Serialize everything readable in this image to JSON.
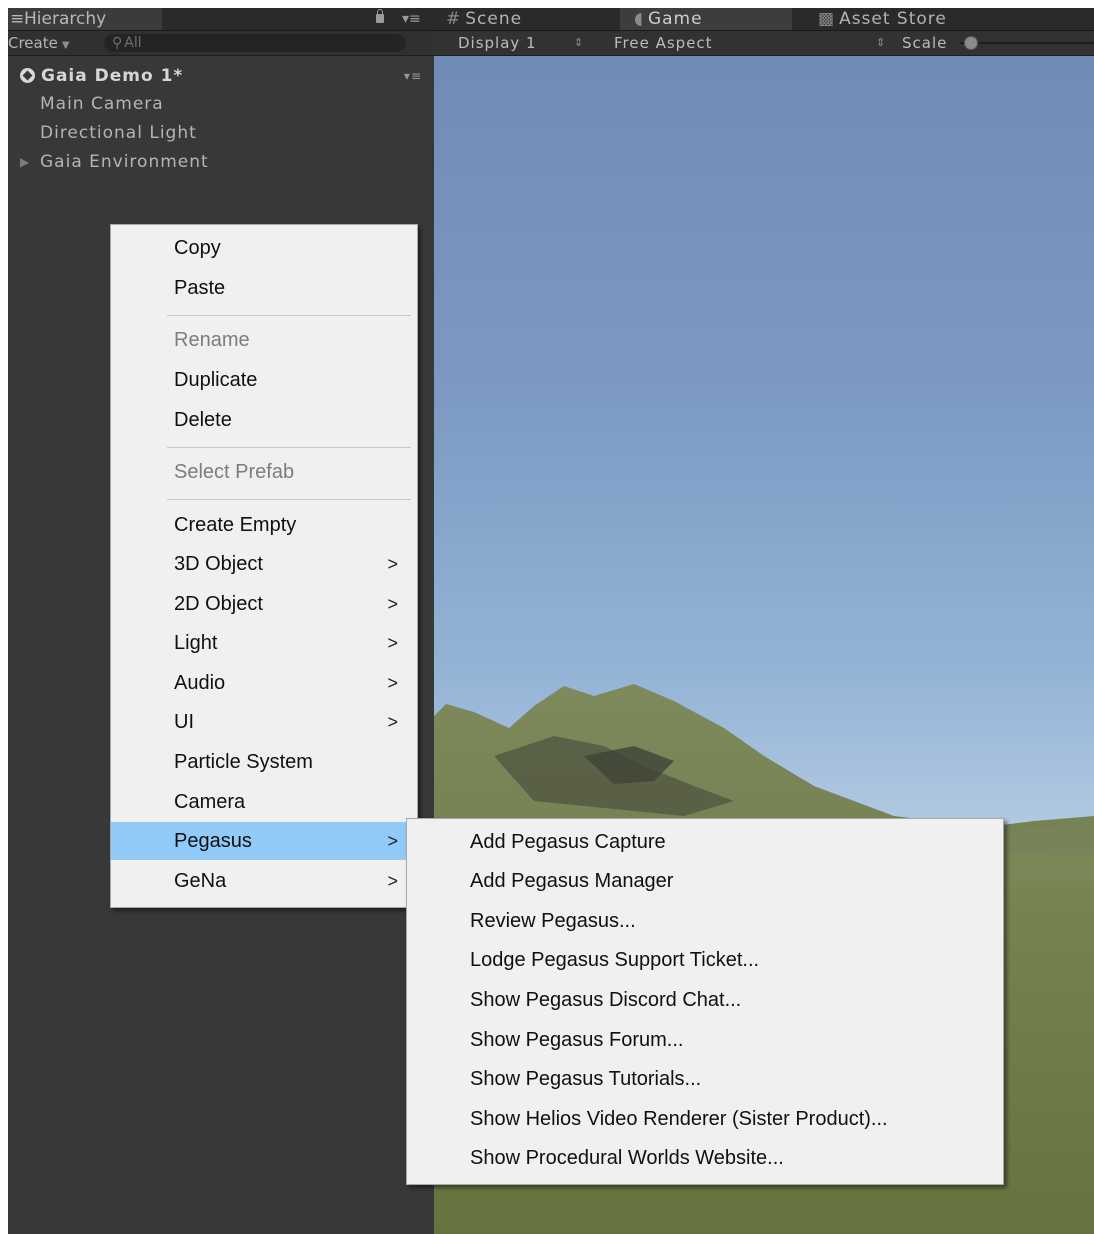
{
  "hierarchy": {
    "tab_label": "Hierarchy",
    "create_label": "Create",
    "search_placeholder": "All",
    "scene_name": "Gaia Demo 1*",
    "items": [
      "Main Camera",
      "Directional Light",
      "Gaia Environment"
    ]
  },
  "gameview": {
    "tabs": [
      "Scene",
      "Game",
      "Asset Store"
    ],
    "display": "Display 1",
    "aspect": "Free Aspect",
    "scale_label": "Scale"
  },
  "context_menu": {
    "items": [
      {
        "label": "Copy",
        "enabled": true
      },
      {
        "label": "Paste",
        "enabled": true
      },
      {
        "label": "Rename",
        "enabled": false
      },
      {
        "label": "Duplicate",
        "enabled": true
      },
      {
        "label": "Delete",
        "enabled": true
      },
      {
        "label": "Select Prefab",
        "enabled": false
      },
      {
        "label": "Create Empty",
        "enabled": true
      },
      {
        "label": "3D Object",
        "submenu": true
      },
      {
        "label": "2D Object",
        "submenu": true
      },
      {
        "label": "Light",
        "submenu": true
      },
      {
        "label": "Audio",
        "submenu": true
      },
      {
        "label": "UI",
        "submenu": true
      },
      {
        "label": "Particle System"
      },
      {
        "label": "Camera"
      },
      {
        "label": "Pegasus",
        "submenu": true,
        "highlighted": true
      },
      {
        "label": "GeNa",
        "submenu": true
      }
    ],
    "submenu_arrow": ">"
  },
  "pegasus_submenu": {
    "items": [
      "Add Pegasus Capture",
      "Add Pegasus Manager",
      "Review Pegasus...",
      "Lodge Pegasus Support Ticket...",
      "Show Pegasus Discord Chat...",
      "Show Pegasus Forum...",
      "Show Pegasus Tutorials...",
      "Show Helios Video Renderer (Sister Product)...",
      "Show Procedural Worlds Website..."
    ]
  },
  "colors": {
    "editor_dark": "#383838",
    "menu_bg": "#f0f0f0",
    "menu_highlight": "#91c9f7",
    "sky_top": "#6f8cb6",
    "terrain": "#6f7d4a"
  }
}
